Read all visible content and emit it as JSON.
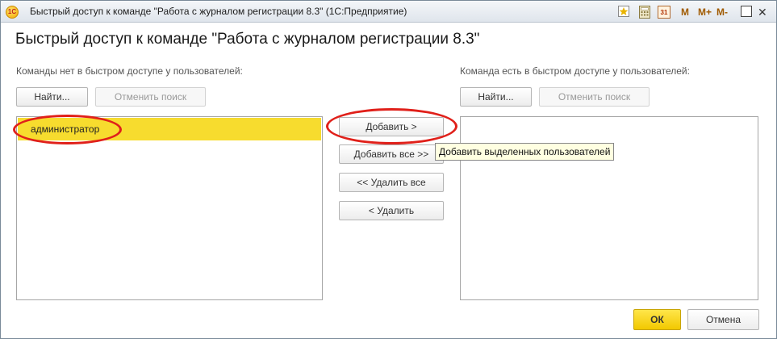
{
  "window": {
    "title": "Быстрый доступ к команде \"Работа с журналом регистрации 8.3\"  (1С:Предприятие)",
    "logo": "1С",
    "toolbar": {
      "calendar_day": "31",
      "m_label": "M",
      "m_plus_label": "M+",
      "m_minus_label": "M-"
    }
  },
  "dialog": {
    "heading": "Быстрый доступ к команде \"Работа с журналом регистрации 8.3\""
  },
  "left_panel": {
    "label": "Команды нет в быстром доступе у пользователей:",
    "find_button": "Найти...",
    "cancel_search_button": "Отменить поиск",
    "items": [
      "администратор"
    ]
  },
  "right_panel": {
    "label": "Команда есть в быстром доступе у пользователей:",
    "find_button": "Найти...",
    "cancel_search_button": "Отменить поиск",
    "items": []
  },
  "actions": {
    "add": "Добавить >",
    "add_all": "Добавить все >>",
    "remove_all": "<< Удалить все",
    "remove": "< Удалить"
  },
  "tooltip": "Добавить выделенных пользователей",
  "footer": {
    "ok": "ОК",
    "cancel": "Отмена"
  },
  "colors": {
    "selection": "#f7dc2e",
    "ok_button": "#f2c800",
    "annotation_ring": "#e0201a"
  }
}
